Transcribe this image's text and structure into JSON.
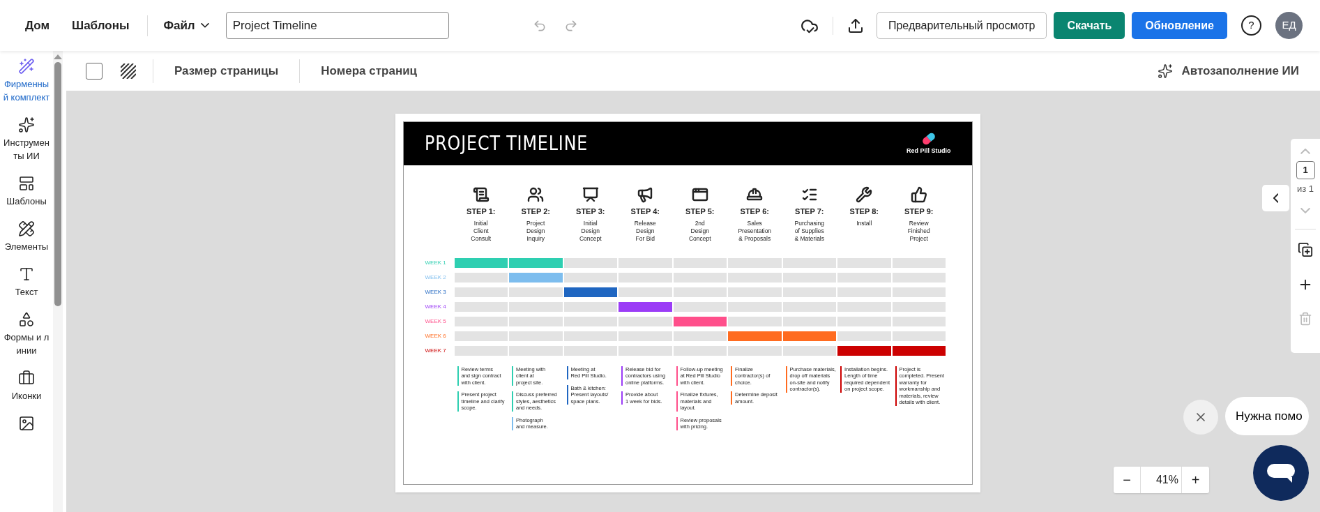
{
  "topbar": {
    "nav": [
      {
        "label": "Дом"
      },
      {
        "label": "Шаблоны"
      }
    ],
    "file_menu": "Файл",
    "doc_title": "Project Timeline",
    "preview": "Предварительный просмотр",
    "download": "Скачать",
    "update": "Обновление",
    "help": "?",
    "avatar": "ЕД"
  },
  "toolbar": {
    "page_size": "Размер страницы",
    "page_numbers": "Номера страниц",
    "ai_fill": "Автозаполнение ИИ"
  },
  "sidebar": {
    "items": [
      {
        "kind": "brand",
        "label": "Фирменный комплект",
        "selected": true
      },
      {
        "kind": "ai",
        "label": "Инструменты ИИ",
        "selected": false
      },
      {
        "kind": "templates",
        "label": "Шаблоны",
        "selected": false
      },
      {
        "kind": "elements",
        "label": "Элементы",
        "selected": false
      },
      {
        "kind": "text",
        "label": "Текст",
        "selected": false
      },
      {
        "kind": "shapes",
        "label": "Формы и линии",
        "selected": false
      },
      {
        "kind": "icons",
        "label": "Иконки",
        "selected": false
      },
      {
        "kind": "images",
        "selected": false
      }
    ]
  },
  "document": {
    "title": "PROJECT TIMELINE",
    "brand": "Red Pill Studio",
    "steps": [
      {
        "kind": "scroll",
        "number": "STEP 1:",
        "title": "Initial\nClient\nConsult"
      },
      {
        "kind": "people",
        "number": "STEP 2:",
        "title": "Project\nDesign\nInquiry"
      },
      {
        "kind": "board",
        "number": "STEP 3:",
        "title": "Initial\nDesign\nConcept"
      },
      {
        "kind": "megaphone",
        "number": "STEP 4:",
        "title": "Release\nDesign\nFor Bid"
      },
      {
        "kind": "layout",
        "number": "STEP 5:",
        "title": "2nd\nDesign\nConcept"
      },
      {
        "kind": "worker",
        "number": "STEP 6:",
        "title": "Sales\nPresentation\n& Proposals"
      },
      {
        "kind": "checklist",
        "number": "STEP 7:",
        "title": "Purchasing\nof Supplies\n& Materials"
      },
      {
        "kind": "tools",
        "number": "STEP 8:",
        "title": "Install"
      },
      {
        "kind": "thumb",
        "number": "STEP 9:",
        "title": "Review\nFinished\nProject"
      }
    ],
    "weeks": [
      {
        "label": "WEEK 1",
        "color": "#2ecfb1",
        "active": [
          true,
          true,
          false,
          false,
          false,
          false,
          false,
          false,
          false
        ]
      },
      {
        "label": "WEEK 2",
        "color": "#7dbdee",
        "active": [
          false,
          true,
          false,
          false,
          false,
          false,
          false,
          false,
          false
        ]
      },
      {
        "label": "WEEK 3",
        "color": "#1f66c1",
        "active": [
          false,
          false,
          true,
          false,
          false,
          false,
          false,
          false,
          false
        ]
      },
      {
        "label": "WEEK 4",
        "color": "#9b3cf6",
        "active": [
          false,
          false,
          false,
          true,
          false,
          false,
          false,
          false,
          false
        ]
      },
      {
        "label": "WEEK 5",
        "color": "#ff4f8b",
        "active": [
          false,
          false,
          false,
          false,
          true,
          false,
          false,
          false,
          false
        ]
      },
      {
        "label": "WEEK 6",
        "color": "#ff6b1f",
        "active": [
          false,
          false,
          false,
          false,
          false,
          true,
          true,
          false,
          false
        ]
      },
      {
        "label": "WEEK 7",
        "color": "#cc0000",
        "active": [
          false,
          false,
          false,
          false,
          false,
          false,
          false,
          true,
          true
        ]
      }
    ],
    "notes": [
      [
        {
          "text": "Review terms\nand sign contract\nwith client.",
          "color": "#2ecfb1"
        },
        {
          "text": "Present project\ntimeline and clarify\nscope.",
          "color": "#2ecfb1"
        }
      ],
      [
        {
          "text": "Meeting with\nclient at\nproject site.",
          "color": "#2ecfb1"
        },
        {
          "text": "Discuss preferred\nstyles, aesthetics\nand needs.",
          "color": "#2ecfb1"
        },
        {
          "text": "Photograph\nand measure.",
          "color": "#7dbdee"
        }
      ],
      [
        {
          "text": "Meeting at\nRed Pill Studio.",
          "color": "#1f66c1"
        },
        {
          "text": "Bath & kitchen:\nPresent layouts/\nspace plans.",
          "color": "#1f66c1"
        }
      ],
      [
        {
          "text": "Release bid for\ncontractors using\nonline platforms.",
          "color": "#9b3cf6"
        },
        {
          "text": "Provide about\n1 week for bids.",
          "color": "#9b3cf6"
        }
      ],
      [
        {
          "text": "Follow-up meeting\nat Red Pill Studio\nwith client.",
          "color": "#ff4f8b"
        },
        {
          "text": "Finalize fixtures,\nmaterials and\nlayout.",
          "color": "#ff4f8b"
        },
        {
          "text": "Review proposals\nwith pricing.",
          "color": "#ff4f8b"
        }
      ],
      [
        {
          "text": "Finalize\ncontractor(s) of\nchoice.",
          "color": "#ff6b1f"
        },
        {
          "text": "Determine deposit\namount.",
          "color": "#ff6b1f"
        }
      ],
      [
        {
          "text": "Purchase materials,\ndrop off materials\non-site and notify\ncontractor(s).",
          "color": "#ff6b1f"
        }
      ],
      [
        {
          "text": "Installation begins.\nLength of time\nrequired dependent\non project scope.",
          "color": "#cc0000"
        }
      ],
      [
        {
          "text": "Project is\ncompleted. Present\nwarranty for\nworkmanship and\nmaterials, review\ndetails with client.",
          "color": "#cc0000"
        }
      ]
    ]
  },
  "pager": {
    "page": "1",
    "of": "из 1"
  },
  "zoom": {
    "minus": "−",
    "value": "41%",
    "plus": "+"
  },
  "help_chat": {
    "prompt": "Нужна помо"
  }
}
